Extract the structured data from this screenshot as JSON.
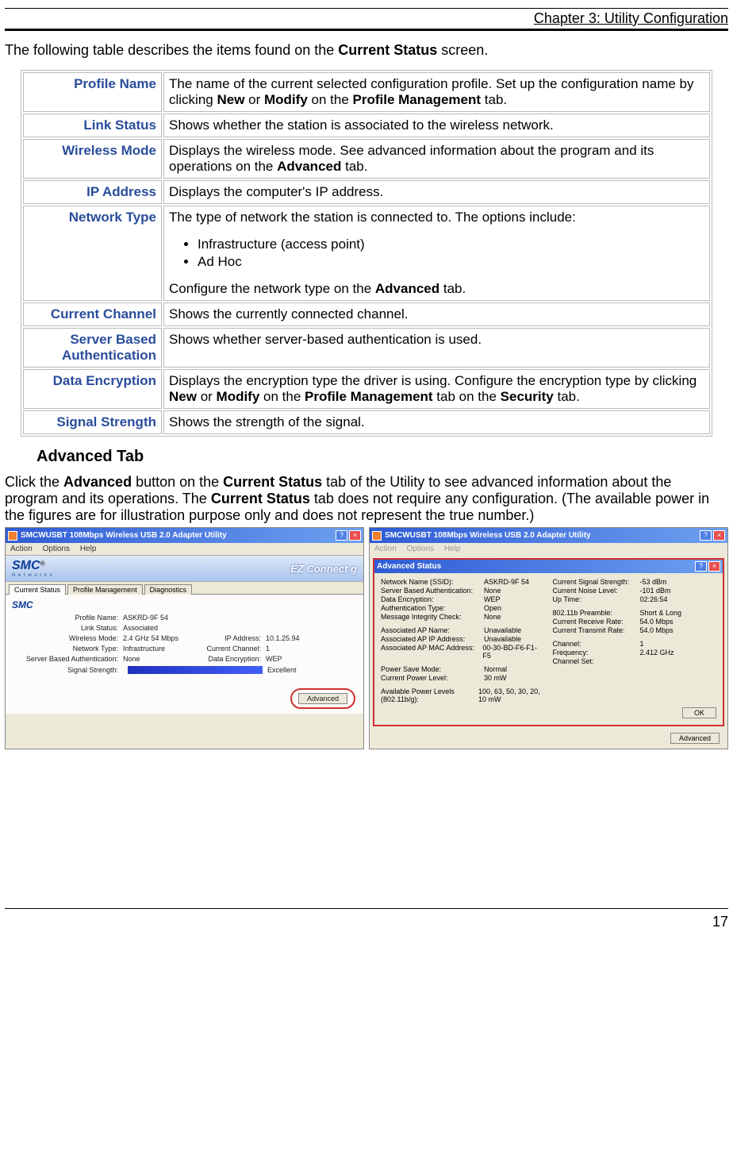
{
  "chapter": "Chapter 3: Utility Configuration",
  "intro_prefix": "The following table describes the items found on the ",
  "intro_bold": "Current Status",
  "intro_suffix": " screen.",
  "table_rows": {
    "r0": {
      "label": "Profile Name",
      "d1": "The name of the current selected configuration profile. Set up the configuration name by clicking ",
      "b1": "New",
      "d2": " or ",
      "b2": "Modify",
      "d3": " on the ",
      "b3": "Profile Management",
      "d4": " tab."
    },
    "r1": {
      "label": "Link Status",
      "desc": "Shows whether the station is associated to the wireless network."
    },
    "r2": {
      "label": "Wireless Mode",
      "d1": "Displays the wireless mode. See advanced information about the program and its operations on the ",
      "b1": "Advanced",
      "d2": " tab."
    },
    "r3": {
      "label": "IP Address",
      "desc": "Displays the computer's IP address."
    },
    "r4": {
      "label": "Network Type",
      "d1": "The type of network the station is connected to. The options include:",
      "li1": "Infrastructure (access point)",
      "li2": "Ad Hoc",
      "d2": "Configure the network type on the ",
      "b1": "Advanced",
      "d3": " tab."
    },
    "r5": {
      "label": "Current Channel",
      "desc": "Shows the currently connected channel."
    },
    "r6": {
      "label": "Server Based Authentication",
      "desc": "Shows whether server-based authentication is used."
    },
    "r7": {
      "label": "Data Encryption",
      "d1": "Displays the encryption type the driver is using. Configure the encryption type by clicking ",
      "b1": "New",
      "d2": " or ",
      "b2": "Modify",
      "d3": " on the ",
      "b3": "Profile Management",
      "d4": " tab on the ",
      "b4": "Security",
      "d5": " tab."
    },
    "r8": {
      "label": "Signal Strength",
      "desc": "Shows the strength of the signal."
    }
  },
  "section_heading": "Advanced Tab",
  "section_intro": {
    "p1": "Click the ",
    "b1": "Advanced",
    "p2": " button on the ",
    "b2": "Current Status",
    "p3": " tab of the Utility to see advanced information about the program and its operations. The ",
    "b3": "Current Status",
    "p4": " tab does not require any configuration. (The available power in the figures are for illustration purpose only and does not represent the true number.)"
  },
  "fig_left": {
    "title": "SMCWUSBT 108Mbps Wireless USB 2.0 Adapter Utility",
    "menu": {
      "a": "Action",
      "o": "Options",
      "h": "Help"
    },
    "logo": "SMC",
    "logo_sub": "N e t w o r k s",
    "ez": "EZ Connect g",
    "tabs": {
      "t1": "Current Status",
      "t2": "Profile Management",
      "t3": "Diagnostics"
    },
    "fields": {
      "profile_l": "Profile Name:",
      "profile_v": "ASKRD-9F 54",
      "link_l": "Link Status:",
      "link_v": "Associated",
      "wmode_l": "Wireless Mode:",
      "wmode_v": "2.4 GHz 54 Mbps",
      "ip_l": "IP Address:",
      "ip_v": "10.1.25.94",
      "ntype_l": "Network Type:",
      "ntype_v": "Infrastructure",
      "chan_l": "Current Channel:",
      "chan_v": "1",
      "sba_l": "Server Based Authentication:",
      "sba_v": "None",
      "denc_l": "Data Encryption:",
      "denc_v": "WEP",
      "sig_l": "Signal Strength:",
      "sig_v": "Excellent"
    },
    "advanced_btn": "Advanced"
  },
  "fig_right": {
    "title": "SMCWUSBT 108Mbps Wireless USB 2.0 Adapter Utility",
    "dlg_title": "Advanced Status",
    "rows": {
      "nn_l": "Network Name (SSID):",
      "nn_v": "ASKRD-9F 54",
      "sba_l": "Server Based Authentication:",
      "sba_v": "None",
      "de_l": "Data Encryption:",
      "de_v": "WEP",
      "at_l": "Authentication Type:",
      "at_v": "Open",
      "mic_l": "Message Integrity Check:",
      "mic_v": "None",
      "apn_l": "Associated AP Name:",
      "apn_v": "Unavailable",
      "apip_l": "Associated AP IP Address:",
      "apip_v": "Unavailable",
      "apmac_l": "Associated AP MAC Address:",
      "apmac_v": "00-30-BD-F6-F1-F5",
      "psm_l": "Power Save Mode:",
      "psm_v": "Normal",
      "cpl_l": "Current Power Level:",
      "cpl_v": "30 mW",
      "apl_l": "Available Power Levels (802.11b/g):",
      "apl_v": "100, 63, 50, 30, 20, 10 mW",
      "css_l": "Current Signal Strength:",
      "css_v": "-53 dBm",
      "cnl_l": "Current Noise Level:",
      "cnl_v": "-101 dBm",
      "ut_l": "Up Time:",
      "ut_v": "02:26:54",
      "pre_l": "802.11b Preamble:",
      "pre_v": "Short & Long",
      "crr_l": "Current Receive Rate:",
      "crr_v": "54.0 Mbps",
      "ctr_l": "Current Transmit Rate:",
      "ctr_v": "54.0 Mbps",
      "ch_l": "Channel:",
      "ch_v": "1",
      "fr_l": "Frequency:",
      "fr_v": "2.412 GHz",
      "cs_l": "Channel Set:"
    },
    "ok": "OK",
    "advanced_btn": "Advanced"
  },
  "page_number": "17"
}
